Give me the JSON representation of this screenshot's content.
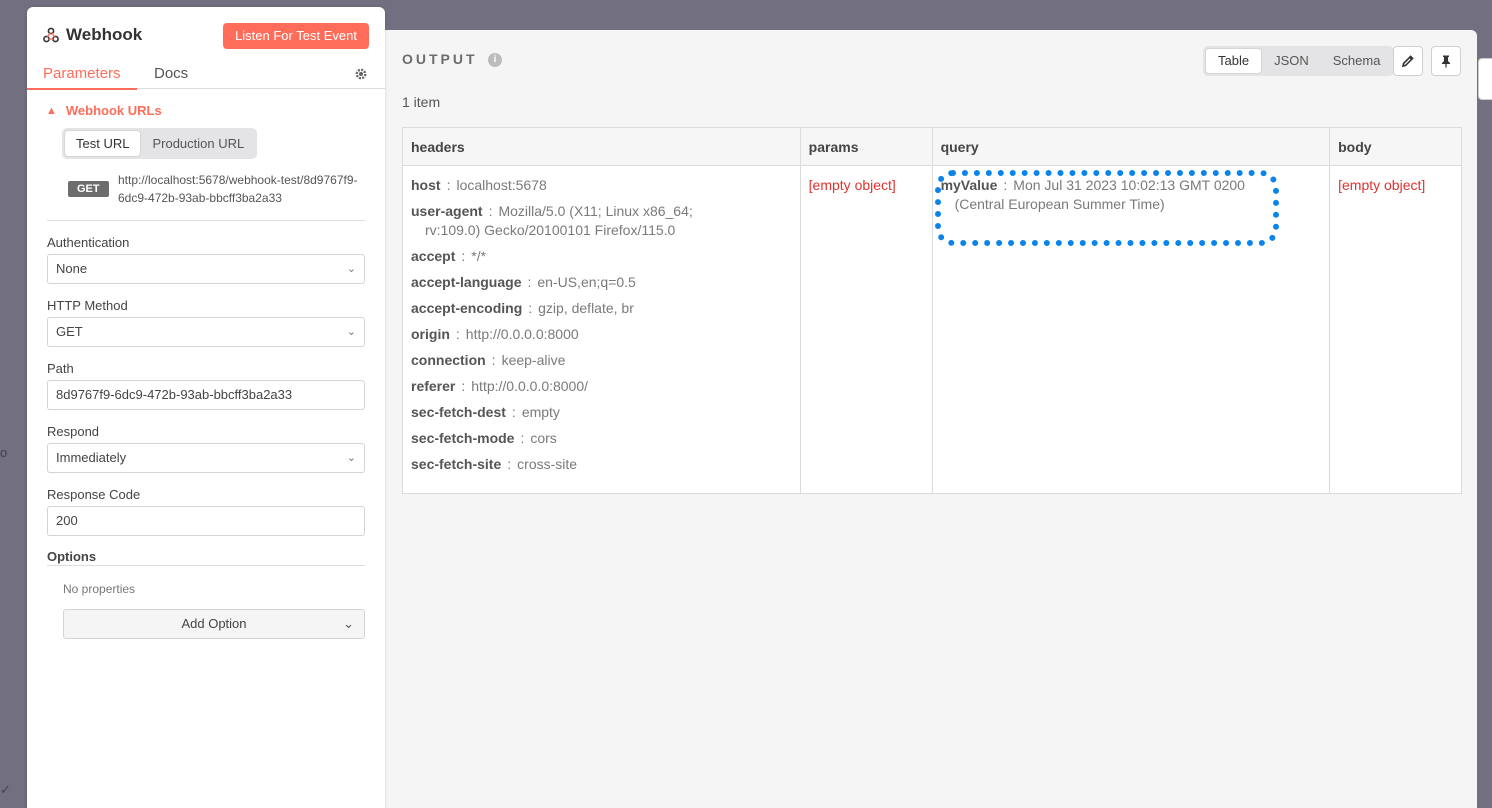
{
  "background": {
    "edge_text": "o",
    "edge_check": "✓"
  },
  "node": {
    "title": "Webhook",
    "listen_button": "Listen For Test Event",
    "tabs": [
      {
        "label": "Parameters"
      },
      {
        "label": "Docs"
      }
    ],
    "webhook_urls": {
      "label": "Webhook URLs",
      "toggle": [
        {
          "label": "Test URL"
        },
        {
          "label": "Production URL"
        }
      ],
      "method_badge": "GET",
      "url": "http://localhost:5678/webhook-test/8d9767f9-6dc9-472b-93ab-bbcff3ba2a33"
    },
    "fields": {
      "authentication": {
        "label": "Authentication",
        "value": "None"
      },
      "http_method": {
        "label": "HTTP Method",
        "value": "GET"
      },
      "path": {
        "label": "Path",
        "value": "8d9767f9-6dc9-472b-93ab-bbcff3ba2a33"
      },
      "respond": {
        "label": "Respond",
        "value": "Immediately"
      },
      "response_code": {
        "label": "Response Code",
        "value": "200"
      }
    },
    "options": {
      "label": "Options",
      "no_properties": "No properties",
      "add_option": "Add Option"
    }
  },
  "output": {
    "title": "OUTPUT",
    "info_icon": "i",
    "item_count": "1 item",
    "views": [
      {
        "label": "Table"
      },
      {
        "label": "JSON"
      },
      {
        "label": "Schema"
      }
    ],
    "active_view": "Table",
    "columns": [
      "headers",
      "params",
      "query",
      "body"
    ],
    "headers": [
      {
        "key": "host",
        "value": "localhost:5678"
      },
      {
        "key": "user-agent",
        "value": "Mozilla/5.0 (X11; Linux x86_64;",
        "value2": "rv:109.0) Gecko/20100101 Firefox/115.0"
      },
      {
        "key": "accept",
        "value": "*/*"
      },
      {
        "key": "accept-language",
        "value": "en-US,en;q=0.5"
      },
      {
        "key": "accept-encoding",
        "value": "gzip, deflate, br"
      },
      {
        "key": "origin",
        "value": "http://0.0.0.0:8000"
      },
      {
        "key": "connection",
        "value": "keep-alive"
      },
      {
        "key": "referer",
        "value": "http://0.0.0.0:8000/"
      },
      {
        "key": "sec-fetch-dest",
        "value": "empty"
      },
      {
        "key": "sec-fetch-mode",
        "value": "cors"
      },
      {
        "key": "sec-fetch-site",
        "value": "cross-site"
      }
    ],
    "params_value": "[empty object]",
    "query": {
      "key": "myValue",
      "value": "Mon Jul 31 2023 10:02:13 GMT 0200",
      "value2": "(Central European Summer Time)"
    },
    "body_value": "[empty object]"
  },
  "colors": {
    "accent": "#ff6d5a",
    "highlight": "#0a84ea",
    "empty": "#e0322e"
  }
}
